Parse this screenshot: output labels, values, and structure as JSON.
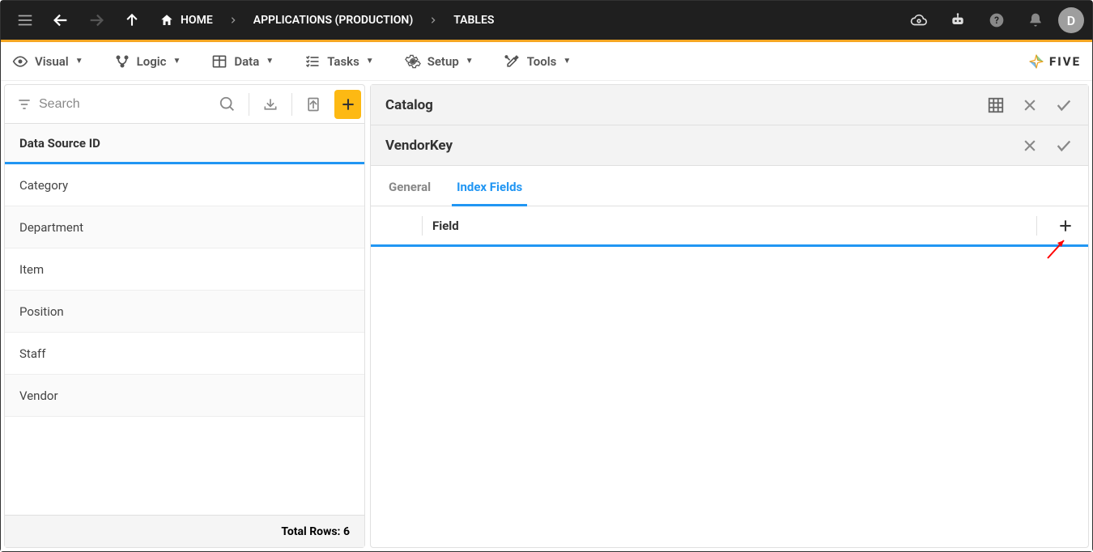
{
  "topbar": {
    "breadcrumbs": [
      "HOME",
      "APPLICATIONS (PRODUCTION)",
      "TABLES"
    ],
    "avatar_letter": "D"
  },
  "menubar": {
    "items": [
      {
        "label": "Visual"
      },
      {
        "label": "Logic"
      },
      {
        "label": "Data"
      },
      {
        "label": "Tasks"
      },
      {
        "label": "Setup"
      },
      {
        "label": "Tools"
      }
    ],
    "brand": "FIVE"
  },
  "left_panel": {
    "search_placeholder": "Search",
    "list_header": "Data Source ID",
    "rows": [
      "Category",
      "Department",
      "Item",
      "Position",
      "Staff",
      "Vendor"
    ],
    "footer": "Total Rows: 6"
  },
  "right_panel": {
    "catalog_title": "Catalog",
    "vendorkey_title": "VendorKey",
    "tabs": [
      {
        "label": "General",
        "active": false
      },
      {
        "label": "Index Fields",
        "active": true
      }
    ],
    "field_column": "Field"
  }
}
